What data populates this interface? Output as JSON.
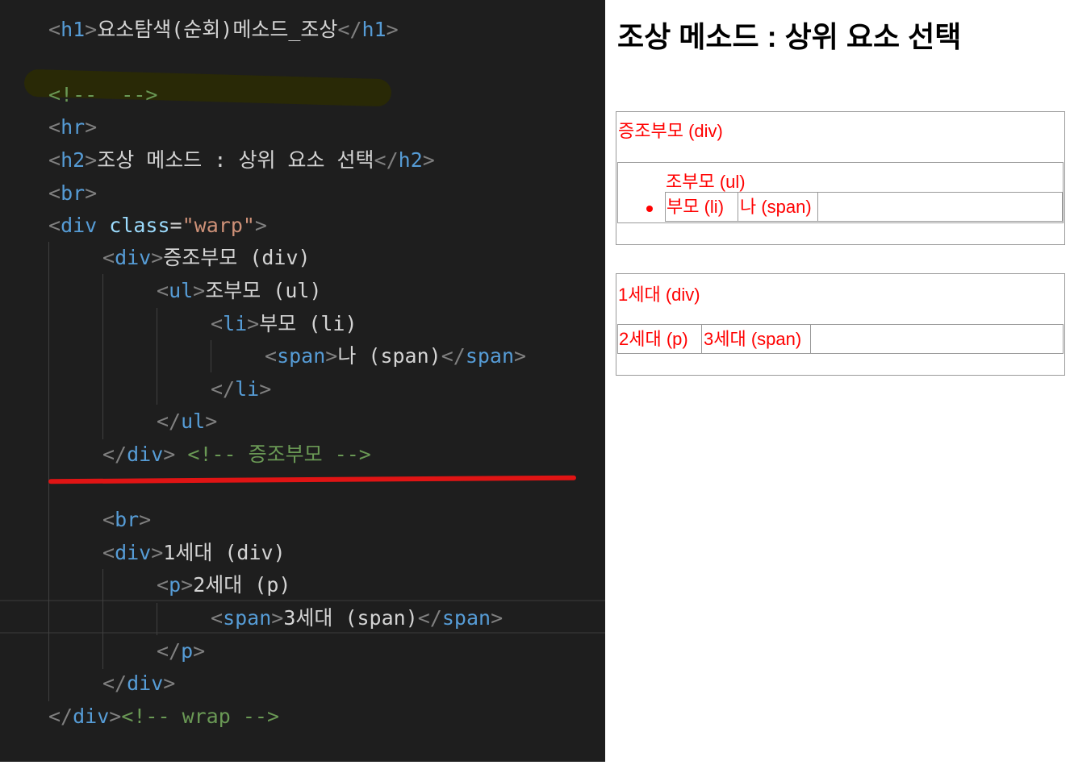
{
  "editor": {
    "lines": {
      "l1": {
        "open_p": "<",
        "tag": "h1",
        "close_p": ">",
        "text": "요소탐색(순회)메소드_조상",
        "end_open": "</",
        "end_tag": "h1",
        "end_close": ">"
      },
      "l2": {
        "comment": "<!--  -->"
      },
      "l3": {
        "open_p": "<",
        "tag": "hr",
        "close_p": ">"
      },
      "l4": {
        "open_p": "<",
        "tag": "h2",
        "close_p": ">",
        "text": "조상 메소드 : 상위 요소 선택",
        "end_open": "</",
        "end_tag": "h2",
        "end_close": ">"
      },
      "l5": {
        "open_p": "<",
        "tag": "br",
        "close_p": ">"
      },
      "l6": {
        "open_p": "<",
        "tag": "div",
        "attr": "class",
        "eq": "=",
        "value": "\"warp\"",
        "close_p": ">"
      },
      "l7": {
        "open_p": "<",
        "tag": "div",
        "close_p": ">",
        "text": "증조부모 (div)"
      },
      "l8": {
        "open_p": "<",
        "tag": "ul",
        "close_p": ">",
        "text": "조부모 (ul)"
      },
      "l9": {
        "open_p": "<",
        "tag": "li",
        "close_p": ">",
        "text": "부모 (li)"
      },
      "l10": {
        "open_p": "<",
        "tag": "span",
        "close_p": ">",
        "text": "나 (span)",
        "end_open": "</",
        "end_tag": "span",
        "end_close": ">"
      },
      "l11": {
        "end_open": "</",
        "end_tag": "li",
        "end_close": ">"
      },
      "l12": {
        "end_open": "</",
        "end_tag": "ul",
        "end_close": ">"
      },
      "l13": {
        "end_open": "</",
        "end_tag": "div",
        "end_close": ">",
        "comment": "<!-- 증조부모 -->"
      },
      "l14": {
        "open_p": "<",
        "tag": "br",
        "close_p": ">"
      },
      "l15": {
        "open_p": "<",
        "tag": "div",
        "close_p": ">",
        "text": "1세대 (div)"
      },
      "l16": {
        "open_p": "<",
        "tag": "p",
        "close_p": ">",
        "text": "2세대 (p)"
      },
      "l17": {
        "open_p": "<",
        "tag": "span",
        "close_p": ">",
        "text": "3세대 (span)",
        "end_open": "</",
        "end_tag": "span",
        "end_close": ">"
      },
      "l18": {
        "end_open": "</",
        "end_tag": "p",
        "end_close": ">"
      },
      "l19": {
        "end_open": "</",
        "end_tag": "div",
        "end_close": ">"
      },
      "l20": {
        "end_open": "</",
        "end_tag": "div",
        "end_close": ">",
        "comment": "<!-- wrap -->"
      }
    },
    "colors": {
      "background": "#1e1e1e",
      "tag": "#569cd6",
      "punct": "#808080",
      "attr": "#9cdcfe",
      "string": "#ce9178",
      "comment": "#6a9955",
      "text": "#d4d4d4",
      "annotation_underline": "#e01414"
    }
  },
  "preview": {
    "title": "조상 메소드 : 상위 요소 선택",
    "group1": {
      "great_grandparent": "증조부모 (div)",
      "grandparent": "조부모 (ul)",
      "parent": "부모 (li)",
      "self": "나 (span)"
    },
    "group2": {
      "gen1": "1세대 (div)",
      "gen2": "2세대 (p)",
      "gen3": "3세대 (span)"
    },
    "text_color": "#ff0000"
  }
}
